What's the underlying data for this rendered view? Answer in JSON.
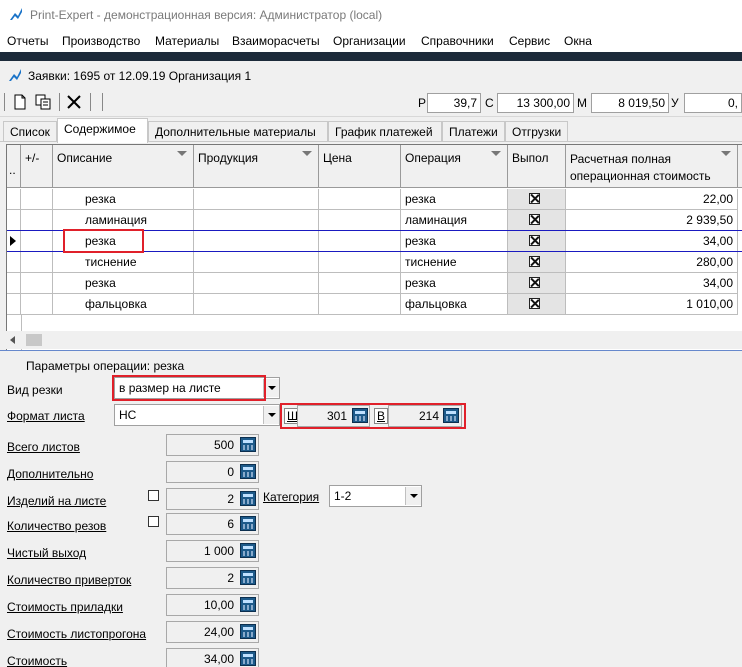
{
  "window": {
    "title": "Print-Expert - демонстрационная версия: Администратор (local)"
  },
  "menu": [
    "Отчеты",
    "Производство",
    "Материалы",
    "Взаиморасчеты",
    "Организации",
    "Справочники",
    "Сервис",
    "Окна"
  ],
  "document": {
    "title": "Заявки: 1695 от 12.09.19  Организация 1"
  },
  "summary": {
    "r_label": "Р",
    "r_value": "39,7",
    "c_label": "С",
    "c_value": "13 300,00",
    "m_label": "М",
    "m_value": "8 019,50",
    "u_label": "У",
    "u_value": "0,"
  },
  "tabs": [
    "Список",
    "Содержимое",
    "Дополнительные материалы",
    "График платежей",
    "Платежи",
    "Отгрузки"
  ],
  "grid": {
    "columns": {
      "plusminus": "+/-",
      "description": "Описание",
      "product": "Продукция",
      "price": "Цена",
      "operation": "Операция",
      "done": "Выпол",
      "cost_line1": "Расчетная полная",
      "cost_line2": "операционная стоимость"
    },
    "rows": [
      {
        "description": "резка",
        "product": "",
        "price": "",
        "operation": "резка",
        "done": true,
        "cost": "22,00"
      },
      {
        "description": "ламинация",
        "product": "",
        "price": "",
        "operation": "ламинация",
        "done": true,
        "cost": "2 939,50"
      },
      {
        "description": "резка",
        "product": "",
        "price": "",
        "operation": "резка",
        "done": true,
        "cost": "34,00"
      },
      {
        "description": "тиснение",
        "product": "",
        "price": "",
        "operation": "тиснение",
        "done": true,
        "cost": "280,00"
      },
      {
        "description": "резка",
        "product": "",
        "price": "",
        "operation": "резка",
        "done": true,
        "cost": "34,00"
      },
      {
        "description": "фальцовка",
        "product": "",
        "price": "",
        "operation": "фальцовка",
        "done": true,
        "cost": "1 010,00"
      }
    ],
    "selected_row": 2
  },
  "params": {
    "header": "Параметры операции: резка",
    "cut_type_label": "Вид резки",
    "cut_type_value": "в размер на листе",
    "sheet_format_label": "Формат листа",
    "sheet_format_value": "НС",
    "width_label": "Ш",
    "width_value": "301",
    "height_label": "В",
    "height_value": "214",
    "fields": [
      {
        "label": "Всего листов",
        "value": "500"
      },
      {
        "label": "Дополнительно",
        "value": "0"
      },
      {
        "label": "Изделий на листе",
        "value": "2"
      },
      {
        "label": "Количество резов",
        "value": "6"
      },
      {
        "label": "Чистый выход",
        "value": "1 000"
      },
      {
        "label": "Количество приверток",
        "value": "2"
      },
      {
        "label": "Стоимость приладки",
        "value": "10,00"
      },
      {
        "label": "Стоимость листопрогона",
        "value": "24,00"
      },
      {
        "label": "Стоимость",
        "value": "34,00"
      }
    ],
    "category_label": "Категория",
    "category_value": "1-2"
  },
  "colors": {
    "highlight": "#e0202a",
    "selection_border": "#1a1ac0",
    "dark_strip": "#1c2a3a"
  }
}
